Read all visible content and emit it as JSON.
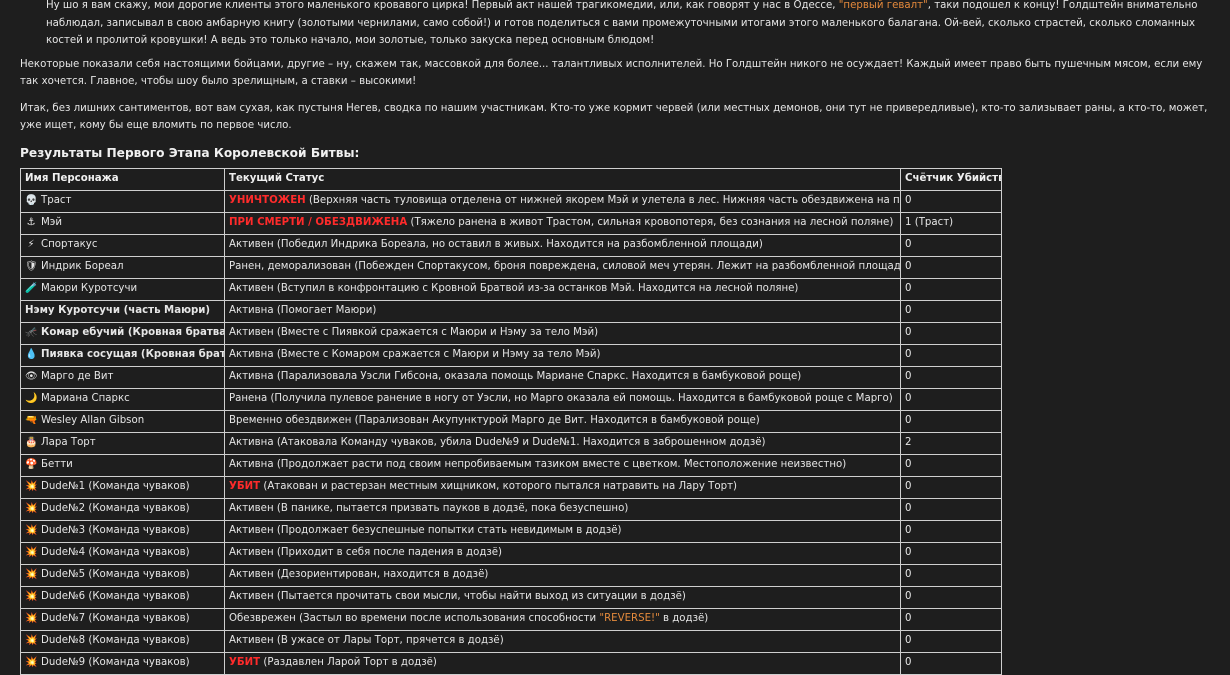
{
  "intro": {
    "p1_a": "Ну шо я вам скажу, мои дорогие клиенты этого маленького кровавого цирка! Первый акт нашей трагикомедии, или, как говорят у нас в Одессе, ",
    "p1_accent": "\"первый гевалт\"",
    "p1_b": ", таки подошел к концу! Голдштейн внимательно наблюдал, записывал в свою амбарную книгу (золотыми чернилами, само собой!) и готов поделиться с вами промежуточными итогами этого маленького балагана. Ой-вей, сколько страстей, сколько сломанных костей и пролитой кровушки! А ведь это только начало, мои золотые, только закуска перед основным блюдом!",
    "p2": "Некоторые показали себя настоящими бойцами, другие – ну, скажем так, массовкой для более... талантливых исполнителей. Но Голдштейн никого не осуждает! Каждый имеет право быть пушечным мясом, если ему так хочется. Главное, чтобы шоу было зрелищным, а ставки – высокими!",
    "p3": "Итак, без лишних сантиментов, вот вам сухая, как пустыня Негев, сводка по нашим участникам. Кто-то уже кормит червей (или местных демонов, они тут не привередливые), кто-то зализывает раны, а кто-то, может, уже ищет, кому бы еще вломить по первое число."
  },
  "table_title": "Результаты Первого Этапа Королевской Битвы:",
  "headers": [
    "Имя Персонажа",
    "Текущий Статус",
    "Счётчик Убийств"
  ],
  "rows": [
    {
      "icon": "💀",
      "name": "Траст",
      "bold": false,
      "status_tag": "УНИЧТОЖЕН",
      "status": " (Верхняя часть туловища отделена от нижней якорем Мэй и улетела в лес. Нижняя часть обездвижена на поляне)",
      "kills": "0"
    },
    {
      "icon": "⚓",
      "name": "Мэй",
      "bold": false,
      "status_tag": "ПРИ СМЕРТИ / ОБЕЗДВИЖЕНА",
      "status": " (Тяжело ранена в живот Трастом, сильная кровопотеря, без сознания на лесной поляне)",
      "kills": "1 (Траст)"
    },
    {
      "icon": "⚡",
      "name": "Спортакус",
      "bold": false,
      "status_tag": "",
      "status": "Активен (Победил Индрика Бореала, но оставил в живых. Находится на разбомбленной площади)",
      "kills": "0"
    },
    {
      "icon": "🛡",
      "name": "Индрик Бореал",
      "bold": false,
      "status_tag": "",
      "status": "Ранен, деморализован (Побежден Спортакусом, броня повреждена, силовой меч утерян. Лежит на разбомбленной площади)",
      "kills": "0"
    },
    {
      "icon": "🧪",
      "name": "Маюри Куротсучи",
      "bold": false,
      "status_tag": "",
      "status": "Активен (Вступил в конфронтацию с Кровной Братвой из-за останков Мэй. Находится на лесной поляне)",
      "kills": "0"
    },
    {
      "icon": "",
      "name": "Нэму Куротсучи (часть Маюри)",
      "bold": true,
      "status_tag": "",
      "status": "Активна (Помогает Маюри)",
      "kills": "0"
    },
    {
      "icon": "🦟",
      "name": "Комар ебучий (Кровная братва)",
      "bold": true,
      "status_tag": "",
      "status": "Активен (Вместе с Пиявкой сражается с Маюри и Нэму за тело Мэй)",
      "kills": "0"
    },
    {
      "icon": "💧",
      "name": "Пиявка сосущая (Кровная братва)",
      "bold": true,
      "status_tag": "",
      "status": "Активна (Вместе с Комаром сражается с Маюри и Нэму за тело Мэй)",
      "kills": "0"
    },
    {
      "icon": "👁",
      "name": "Марго де Вит",
      "bold": false,
      "status_tag": "",
      "status": "Активна (Парализовала Уэсли Гибсона, оказала помощь Мариане Спаркс. Находится в бамбуковой роще)",
      "kills": "0"
    },
    {
      "icon": "🌙",
      "name": "Мариана Спаркс",
      "bold": false,
      "status_tag": "",
      "status": "Ранена (Получила пулевое ранение в ногу от Уэсли, но Марго оказала ей помощь. Находится в бамбуковой роще с Марго)",
      "kills": "0"
    },
    {
      "icon": "🔫",
      "name": "Wesley Allan Gibson",
      "bold": false,
      "status_tag": "",
      "status": "Временно обездвижен (Парализован Акупунктурой Марго де Вит. Находится в бамбуковой роще)",
      "kills": "0"
    },
    {
      "icon": "🎂",
      "name": "Лара Торт",
      "bold": false,
      "status_tag": "",
      "status": "Активна (Атаковала Команду чуваков, убила Dude№9 и Dude№1. Находится в заброшенном додзё)",
      "kills": "2"
    },
    {
      "icon": "🍄",
      "name": "Бетти",
      "bold": false,
      "status_tag": "",
      "status": "Активна (Продолжает расти под своим непробиваемым тазиком вместе с цветком. Местоположение неизвестно)",
      "kills": "0"
    },
    {
      "icon": "💥",
      "name": "Dude№1 (Команда чуваков)",
      "bold": false,
      "status_tag": "УБИТ",
      "status": " (Атакован и растерзан местным хищником, которого пытался натравить на Лару Торт)",
      "kills": "0"
    },
    {
      "icon": "💥",
      "name": "Dude№2 (Команда чуваков)",
      "bold": false,
      "status_tag": "",
      "status": "Активен (В панике, пытается призвать пауков в додзё, пока безуспешно)",
      "kills": "0"
    },
    {
      "icon": "💥",
      "name": "Dude№3 (Команда чуваков)",
      "bold": false,
      "status_tag": "",
      "status": "Активен (Продолжает безуспешные попытки стать невидимым в додзё)",
      "kills": "0"
    },
    {
      "icon": "💥",
      "name": "Dude№4 (Команда чуваков)",
      "bold": false,
      "status_tag": "",
      "status": "Активен (Приходит в себя после падения в додзё)",
      "kills": "0"
    },
    {
      "icon": "💥",
      "name": "Dude№5 (Команда чуваков)",
      "bold": false,
      "status_tag": "",
      "status": "Активен (Дезориентирован, находится в додзё)",
      "kills": "0"
    },
    {
      "icon": "💥",
      "name": "Dude№6 (Команда чуваков)",
      "bold": false,
      "status_tag": "",
      "status": "Активен (Пытается прочитать свои мысли, чтобы найти выход из ситуации в додзё)",
      "kills": "0"
    },
    {
      "icon": "💥",
      "name": "Dude№7 (Команда чуваков)",
      "bold": false,
      "status_tag": "",
      "status": "Обезврежен (Застыл во времени после использования способности ",
      "status_accent": "\"REVERSE!\"",
      "status_tail": " в додзё)",
      "kills": "0"
    },
    {
      "icon": "💥",
      "name": "Dude№8 (Команда чуваков)",
      "bold": false,
      "status_tag": "",
      "status": "Активен (В ужасе от Лары Торт, прячется в додзё)",
      "kills": "0"
    },
    {
      "icon": "💥",
      "name": "Dude№9 (Команда чуваков)",
      "bold": false,
      "status_tag": "УБИТ",
      "status": " (Раздавлен Ларой Торт в додзё)",
      "kills": "0"
    }
  ],
  "colors": {
    "background": "#1e1e1e",
    "text": "#e6e6e6",
    "accent": "#e58a3c",
    "status_red": "#ff2b2b"
  }
}
